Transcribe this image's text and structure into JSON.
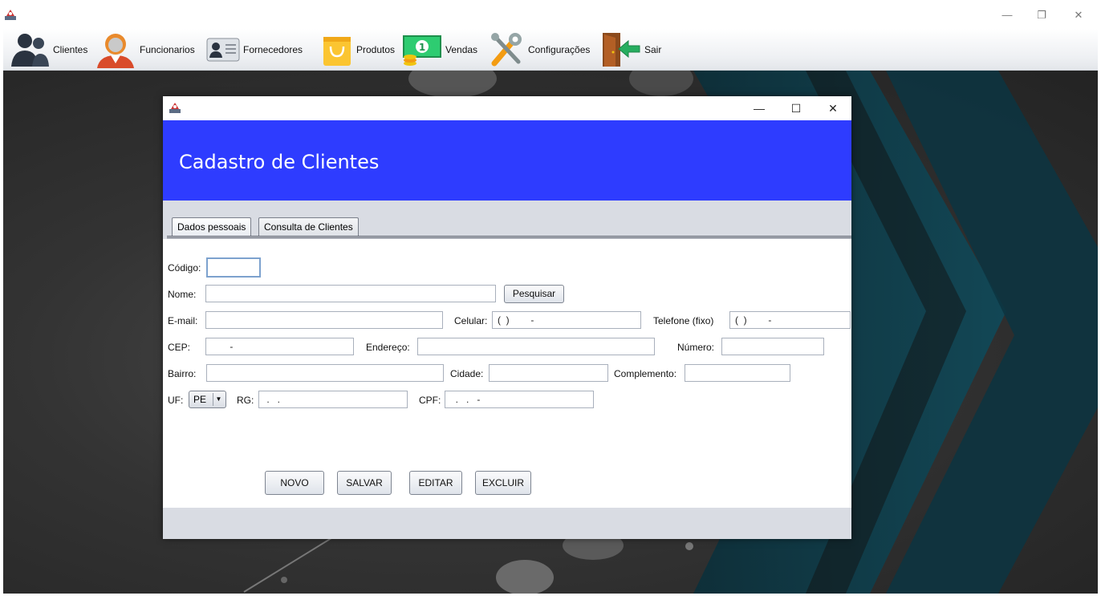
{
  "window": {
    "minimize": "—",
    "restore": "❐",
    "close": "✕"
  },
  "menu": [
    {
      "label": "Clientes",
      "icon": "clients-icon"
    },
    {
      "label": "Funcionarios",
      "icon": "employee-icon"
    },
    {
      "label": "Fornecedores",
      "icon": "id-card-icon"
    },
    {
      "label": "Produtos",
      "icon": "shopping-bag-icon"
    },
    {
      "label": "Vendas",
      "icon": "money-icon"
    },
    {
      "label": "Configurações",
      "icon": "tools-icon"
    },
    {
      "label": "Sair",
      "icon": "exit-door-icon"
    }
  ],
  "frame": {
    "minimize": "—",
    "maximize": "☐",
    "close": "✕",
    "title": "Cadastro de Clientes",
    "header_color": "#2e3cff",
    "tabs": [
      {
        "label": "Dados pessoais",
        "active": true
      },
      {
        "label": "Consulta de Clientes",
        "active": false
      }
    ]
  },
  "form": {
    "codigo_label": "Código:",
    "codigo_value": "",
    "nome_label": "Nome:",
    "nome_value": "",
    "pesquisar_label": "Pesquisar",
    "email_label": "E-mail:",
    "email_value": "",
    "celular_label": "Celular:",
    "celular_value": "(  )        -",
    "telefone_label": "Telefone (fixo)",
    "telefone_value": "(  )        -",
    "cep_label": "CEP:",
    "cep_value": "       -",
    "endereco_label": "Endereço:",
    "endereco_value": "",
    "numero_label": "Número:",
    "numero_value": "",
    "bairro_label": "Bairro:",
    "bairro_value": "",
    "cidade_label": "Cidade:",
    "cidade_value": "",
    "complemento_label": "Complemento:",
    "complemento_value": "",
    "uf_label": "UF:",
    "uf_value": "PE",
    "rg_label": "RG:",
    "rg_value": " .   .",
    "cpf_label": "CPF:",
    "cpf_value": "  .   .   -"
  },
  "actions": {
    "novo": "NOVO",
    "salvar": "SALVAR",
    "editar": "EDITAR",
    "excluir": "EXCLUIR"
  }
}
